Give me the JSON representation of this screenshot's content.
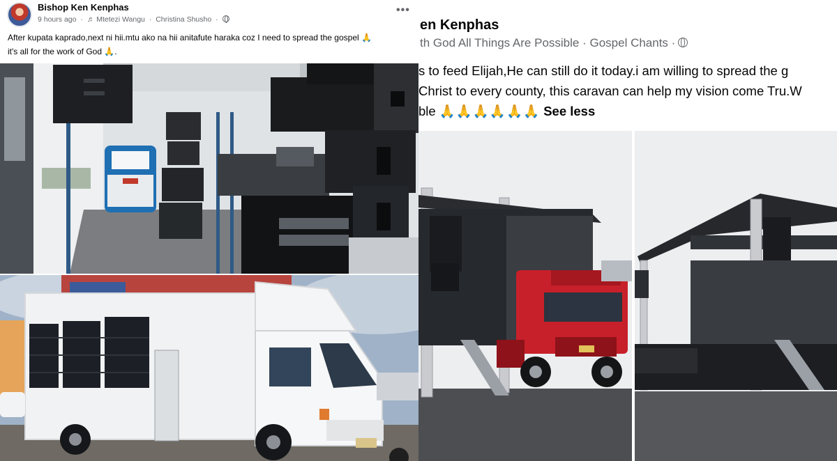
{
  "left_post": {
    "author": "Bishop Ken Kenphas",
    "time": "9 hours ago",
    "music_icon": "music-note-icon",
    "song": "Mtetezi Wangu",
    "artist": "Christina Shusho",
    "privacy_icon": "globe-icon",
    "more_label": "•••",
    "caption_line1": "After kupata kaprado,next ni hii.mtu ako na hii anitafute haraka coz I need to spread the gospel 🙏",
    "caption_line2": "it's all for the work of God 🙏.",
    "photos": [
      "stage-interior-speakers",
      "white-hino-truck"
    ]
  },
  "right_post": {
    "author": "en Kenphas",
    "meta": "th God All Things Are Possible · Gospel Chants ·",
    "line1": "s to feed Elijah,He can still do it today.i am willing to spread the g",
    "line2": "Christ to every county, this caravan can help my vision come Tru.W",
    "line3_start": "ble ",
    "line3_emoji": "🙏🙏🙏🙏🙏🙏",
    "see_less": "See less",
    "photos": [
      "red-truck-stage",
      "mobile-stage-side"
    ]
  },
  "colors": {
    "text": "#050505",
    "meta": "#65676b",
    "truck_red": "#c8202a",
    "truck_white": "#f2f2f2"
  }
}
